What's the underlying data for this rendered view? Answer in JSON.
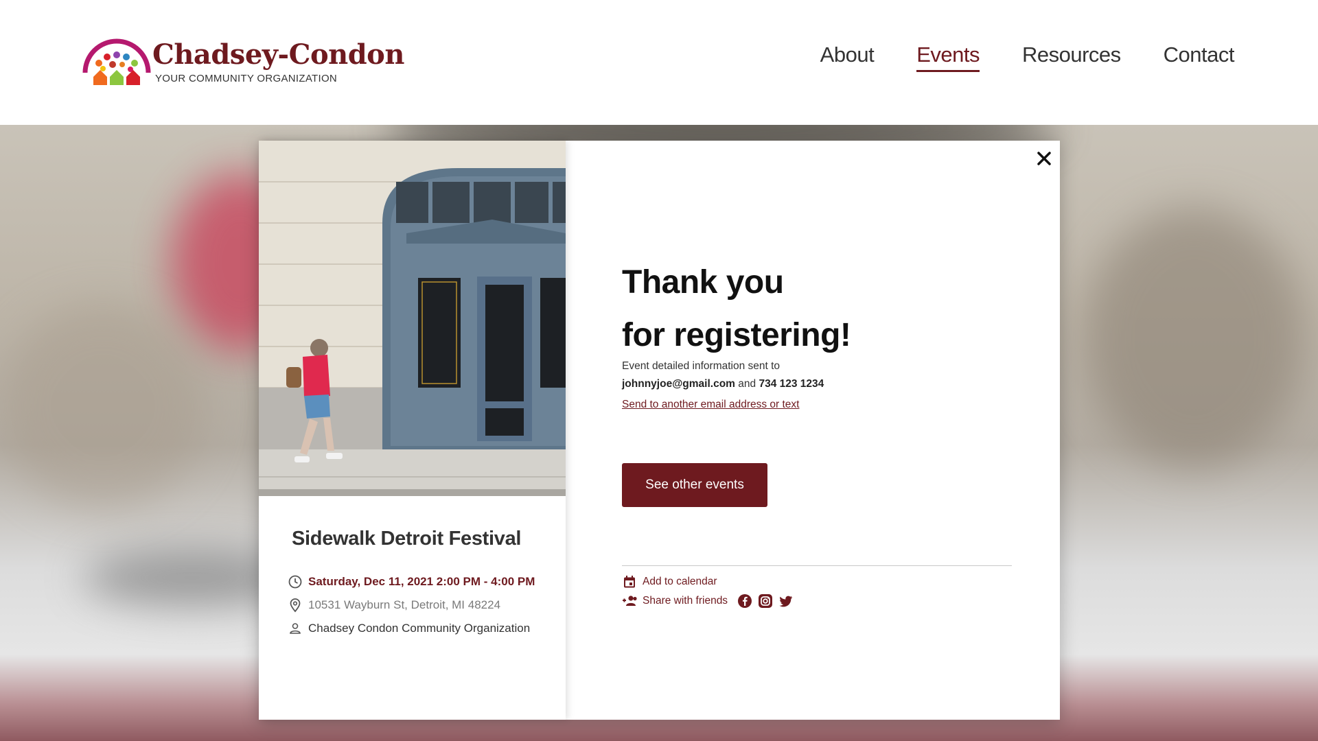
{
  "brand": {
    "name": "Chadsey-Condon",
    "tagline": "YOUR COMMUNITY ORGANIZATION",
    "colors": {
      "primary": "#6e1a1f",
      "logo_arc": "#b5196e",
      "house_orange": "#f06a1e",
      "house_green": "#8cc63f",
      "house_red": "#d7202a"
    }
  },
  "nav": {
    "items": [
      {
        "label": "About",
        "active": false
      },
      {
        "label": "Events",
        "active": true
      },
      {
        "label": "Resources",
        "active": false
      },
      {
        "label": "Contact",
        "active": false
      }
    ]
  },
  "modal": {
    "close_icon": "close-icon",
    "event": {
      "title": "Sidewalk Detroit Festival",
      "datetime": "Saturday, Dec 11, 2021 2:00 PM - 4:00 PM",
      "location": "10531 Wayburn St, Detroit, MI 48224",
      "organizer": "Chadsey Condon Community Organization",
      "icons": {
        "datetime": "clock-icon",
        "location": "location-pin-icon",
        "organizer": "person-icon"
      }
    },
    "confirmation": {
      "heading_line1": "Thank you",
      "heading_line2": "for registering!",
      "sent_text": "Event detailed information sent to",
      "email": "johnnyjoe@gmail.com",
      "and_text": "and",
      "phone": "734 123 1234",
      "resend_link": "Send to another email address or text",
      "see_events_button": "See other events",
      "add_calendar": "Add to calendar",
      "share_friends": "Share with friends",
      "social_icons": [
        "facebook-icon",
        "instagram-icon",
        "twitter-icon"
      ]
    }
  }
}
